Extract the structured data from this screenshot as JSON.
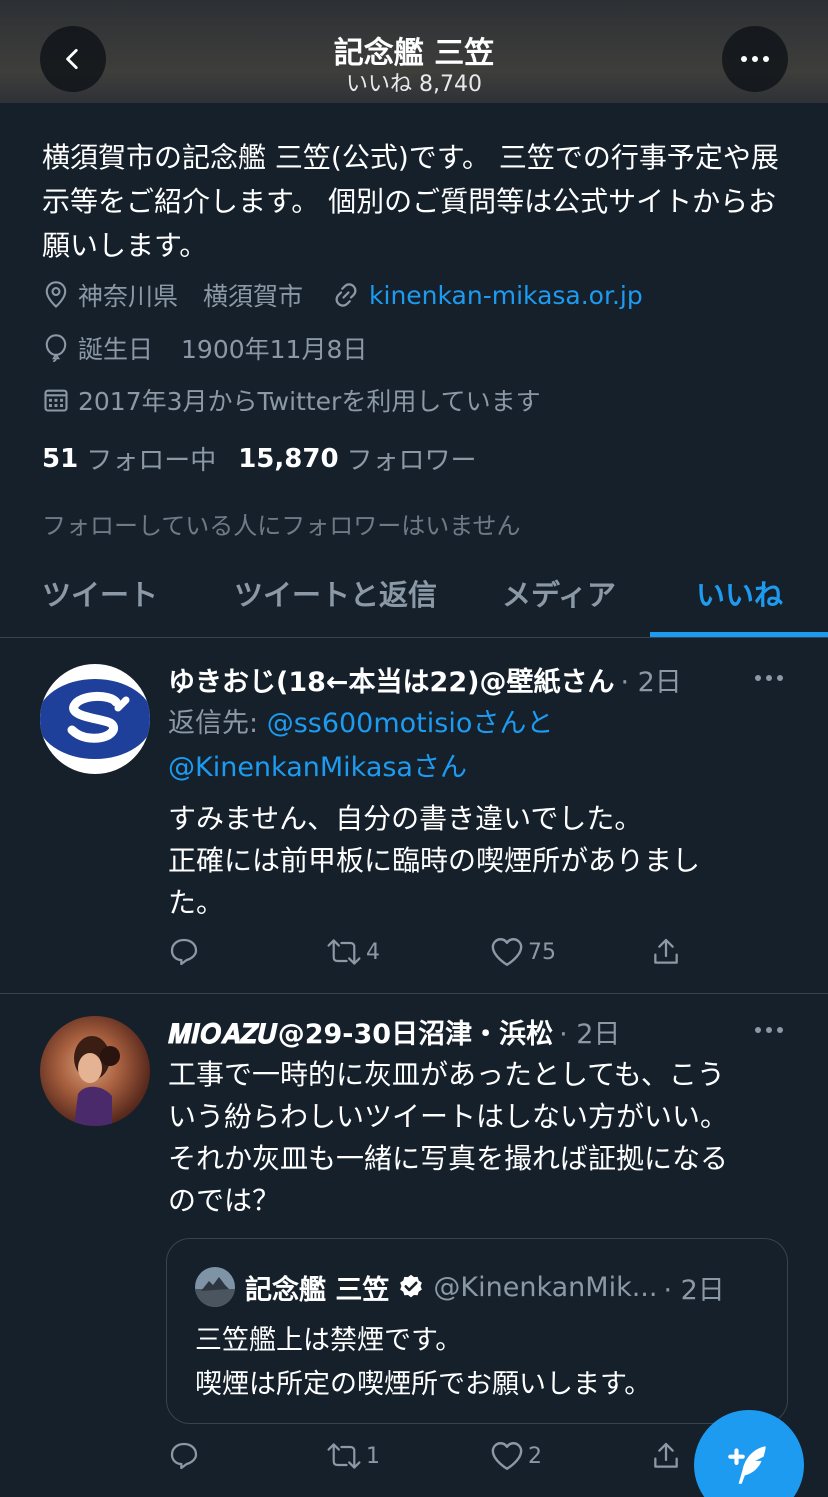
{
  "header": {
    "title": "記念艦 三笠",
    "subtitle": "いいね 8,740"
  },
  "profile": {
    "bio": "横須賀市の記念艦 三笠(公式)です。 三笠での行事予定や展示等をご紹介します。 個別のご質問等は公式サイトからお願いします。",
    "location": "神奈川県　横須賀市",
    "url": "kinenkan-mikasa.or.jp",
    "birthday_label": "誕生日",
    "birthday": "1900年11月8日",
    "joined": "2017年3月からTwitterを利用しています",
    "following_count": "51",
    "following_label": "フォロー中",
    "followers_count": "15,870",
    "followers_label": "フォロワー",
    "no_common_followers": "フォローしている人にフォロワーはいません"
  },
  "tabs": [
    {
      "label": "ツイート",
      "active": false
    },
    {
      "label": "ツイートと返信",
      "active": false
    },
    {
      "label": "メディア",
      "active": false
    },
    {
      "label": "いいね",
      "active": true
    }
  ],
  "tweets": [
    {
      "name": "ゆきおじ(18←本当は22)@壁紙さん",
      "time": "· 2日",
      "reply_prefix": "返信先: ",
      "reply_to_1": "@ss600motisioさんと",
      "reply_to_2": "@KinenkanMikasaさん",
      "text_lines": [
        "すみません、自分の書き違いでした。",
        "正確には前甲板に臨時の喫煙所がありまし",
        "た。"
      ],
      "retweets": "4",
      "likes": "75"
    },
    {
      "name": "𝑴𝑰𝑶𝑨𝒁𝑼@29-30日沼津・浜松",
      "time": "· 2日",
      "text_lines": [
        "工事で一時的に灰皿があったとしても、こう",
        "いう紛らわしいツイートはしない方がいい。",
        "それか灰皿も一緒に写真を撮れば証拠になる",
        "のでは？"
      ],
      "retweets": "1",
      "likes": "2",
      "quote": {
        "name": "記念艦 三笠",
        "handle": "@KinenkanMik...",
        "time": "· 2日",
        "text_lines": [
          "三笠艦上は禁煙です。",
          "喫煙は所定の喫煙所でお願いします。"
        ]
      }
    }
  ],
  "colors": {
    "background": "#15202b",
    "accent": "#1d9bf0",
    "secondary_text": "#8b98a5",
    "divider": "#38444d"
  },
  "icons": {
    "back": "chevron-left-icon",
    "more": "more-icon",
    "location": "location-pin-icon",
    "link": "link-icon",
    "birthday": "balloon-icon",
    "joined": "calendar-icon",
    "reply": "reply-icon",
    "retweet": "retweet-icon",
    "like": "heart-icon",
    "share": "share-icon",
    "verified": "verified-badge-icon",
    "compose": "compose-tweet-icon"
  }
}
